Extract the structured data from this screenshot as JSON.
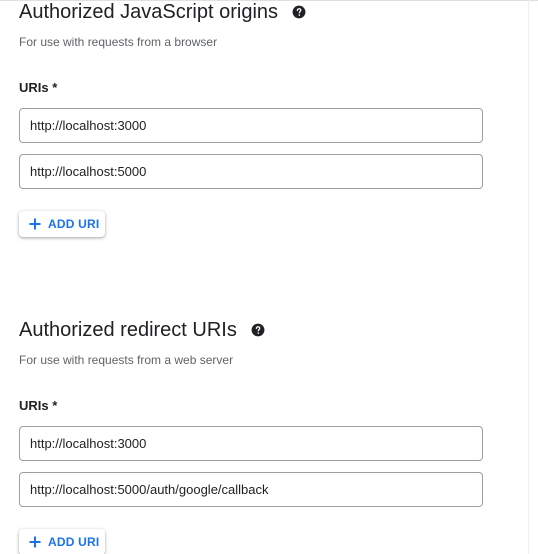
{
  "colors": {
    "accent": "#1a73e8",
    "text_primary": "#202124",
    "text_secondary": "#5f6368",
    "input_border": "#9aa0a6"
  },
  "js_origins": {
    "title": "Authorized JavaScript origins",
    "help_icon": "help-circle-icon",
    "description": "For use with requests from a browser",
    "uris_label": "URIs *",
    "uris": [
      "http://localhost:3000",
      "http://localhost:5000"
    ],
    "add_button": {
      "icon": "plus-icon",
      "label": "ADD URI"
    }
  },
  "redirect_uris": {
    "title": "Authorized redirect URIs",
    "help_icon": "help-circle-icon",
    "description": "For use with requests from a web server",
    "uris_label": "URIs *",
    "uris": [
      "http://localhost:3000",
      "http://localhost:5000/auth/google/callback"
    ],
    "add_button": {
      "icon": "plus-icon",
      "label": "ADD URI"
    }
  }
}
